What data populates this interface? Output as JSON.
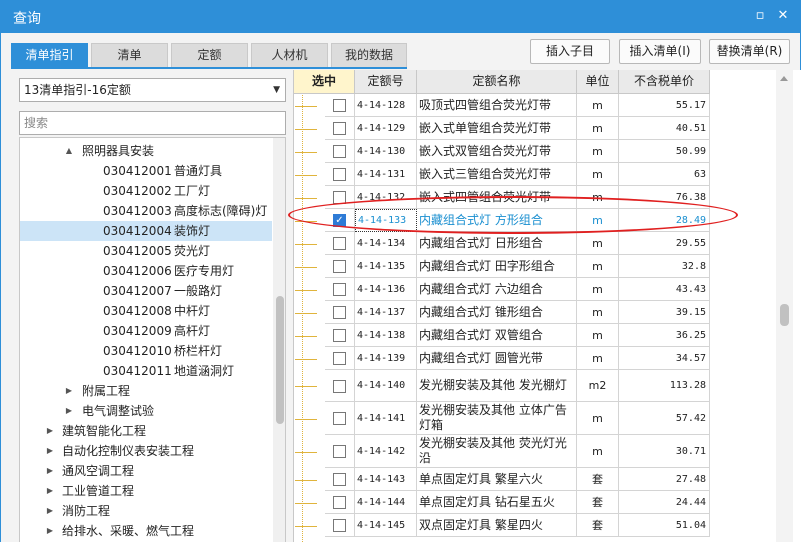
{
  "window": {
    "title": "查询",
    "restore_icon": "restore-icon",
    "close_icon": "close-icon"
  },
  "tabs": [
    {
      "label": "清单指引",
      "active": true
    },
    {
      "label": "清单",
      "active": false
    },
    {
      "label": "定额",
      "active": false
    },
    {
      "label": "人材机",
      "active": false
    },
    {
      "label": "我的数据",
      "active": false
    }
  ],
  "toolbar": {
    "insert_child": "插入子目",
    "insert_list": "插入清单(I)",
    "replace_list": "替换清单(R)"
  },
  "left": {
    "combo_value": "13清单指引-16定额",
    "search_placeholder": "搜索",
    "tree": [
      {
        "level": 2,
        "toggle": "▲",
        "code": "",
        "name": "照明器具安装"
      },
      {
        "level": 3,
        "toggle": "",
        "code": "030412001",
        "name": "普通灯具"
      },
      {
        "level": 3,
        "toggle": "",
        "code": "030412002",
        "name": "工厂灯"
      },
      {
        "level": 3,
        "toggle": "",
        "code": "030412003",
        "name": "高度标志(障碍)灯"
      },
      {
        "level": 3,
        "toggle": "",
        "code": "030412004",
        "name": "装饰灯",
        "selected": true
      },
      {
        "level": 3,
        "toggle": "",
        "code": "030412005",
        "name": "荧光灯"
      },
      {
        "level": 3,
        "toggle": "",
        "code": "030412006",
        "name": "医疗专用灯"
      },
      {
        "level": 3,
        "toggle": "",
        "code": "030412007",
        "name": "一般路灯"
      },
      {
        "level": 3,
        "toggle": "",
        "code": "030412008",
        "name": "中杆灯"
      },
      {
        "level": 3,
        "toggle": "",
        "code": "030412009",
        "name": "高杆灯"
      },
      {
        "level": 3,
        "toggle": "",
        "code": "030412010",
        "name": "桥栏杆灯"
      },
      {
        "level": 3,
        "toggle": "",
        "code": "030412011",
        "name": "地道涵洞灯"
      },
      {
        "level": 2,
        "toggle": "▶",
        "code": "",
        "name": "附属工程"
      },
      {
        "level": 2,
        "toggle": "▶",
        "code": "",
        "name": "电气调整试验"
      },
      {
        "level": 1,
        "toggle": "▶",
        "code": "",
        "name": "建筑智能化工程"
      },
      {
        "level": 1,
        "toggle": "▶",
        "code": "",
        "name": "自动化控制仪表安装工程"
      },
      {
        "level": 1,
        "toggle": "▶",
        "code": "",
        "name": "通风空调工程"
      },
      {
        "level": 1,
        "toggle": "▶",
        "code": "",
        "name": "工业管道工程"
      },
      {
        "level": 1,
        "toggle": "▶",
        "code": "",
        "name": "消防工程"
      },
      {
        "level": 1,
        "toggle": "▶",
        "code": "",
        "name": "给排水、采暖、燃气工程"
      }
    ]
  },
  "grid": {
    "headers": {
      "select": "选中",
      "code": "定额号",
      "name": "定额名称",
      "unit": "单位",
      "price": "不含税单价"
    },
    "rows": [
      {
        "code": "4-14-128",
        "name": "吸顶式四管组合荧光灯带",
        "unit": "m",
        "price": "55.17",
        "checked": false,
        "h": 23
      },
      {
        "code": "4-14-129",
        "name": "嵌入式单管组合荧光灯带",
        "unit": "m",
        "price": "40.51",
        "checked": false,
        "h": 23
      },
      {
        "code": "4-14-130",
        "name": "嵌入式双管组合荧光灯带",
        "unit": "m",
        "price": "50.99",
        "checked": false,
        "h": 23
      },
      {
        "code": "4-14-131",
        "name": "嵌入式三管组合荧光灯带",
        "unit": "m",
        "price": "63",
        "checked": false,
        "h": 23
      },
      {
        "code": "4-14-132",
        "name": "嵌入式四管组合荧光灯带",
        "unit": "m",
        "price": "76.38",
        "checked": false,
        "h": 23
      },
      {
        "code": "4-14-133",
        "name": "内藏组合式灯 方形组合",
        "unit": "m",
        "price": "28.49",
        "checked": true,
        "highlight": true,
        "h": 23
      },
      {
        "code": "4-14-134",
        "name": "内藏组合式灯 日形组合",
        "unit": "m",
        "price": "29.55",
        "checked": false,
        "h": 23
      },
      {
        "code": "4-14-135",
        "name": "内藏组合式灯 田字形组合",
        "unit": "m",
        "price": "32.8",
        "checked": false,
        "h": 23
      },
      {
        "code": "4-14-136",
        "name": "内藏组合式灯 六边组合",
        "unit": "m",
        "price": "43.43",
        "checked": false,
        "h": 23
      },
      {
        "code": "4-14-137",
        "name": "内藏组合式灯 锥形组合",
        "unit": "m",
        "price": "39.15",
        "checked": false,
        "h": 23
      },
      {
        "code": "4-14-138",
        "name": "内藏组合式灯 双管组合",
        "unit": "m",
        "price": "36.25",
        "checked": false,
        "h": 23
      },
      {
        "code": "4-14-139",
        "name": "内藏组合式灯 圆管光带",
        "unit": "m",
        "price": "34.57",
        "checked": false,
        "h": 23
      },
      {
        "code": "4-14-140",
        "name": "发光棚安装及其他 发光棚灯",
        "unit": "m2",
        "price": "113.28",
        "checked": false,
        "h": 32
      },
      {
        "code": "4-14-141",
        "name": "发光棚安装及其他 立体广告灯箱",
        "unit": "m",
        "price": "57.42",
        "checked": false,
        "h": 33
      },
      {
        "code": "4-14-142",
        "name": "发光棚安装及其他 荧光灯光沿",
        "unit": "m",
        "price": "30.71",
        "checked": false,
        "h": 33
      },
      {
        "code": "4-14-143",
        "name": "单点固定灯具 繁星六火",
        "unit": "套",
        "price": "27.48",
        "checked": false,
        "h": 23
      },
      {
        "code": "4-14-144",
        "name": "单点固定灯具 钻石星五火",
        "unit": "套",
        "price": "24.44",
        "checked": false,
        "h": 23
      },
      {
        "code": "4-14-145",
        "name": "双点固定灯具 繁星四火",
        "unit": "套",
        "price": "51.04",
        "checked": false,
        "h": 23
      }
    ]
  }
}
